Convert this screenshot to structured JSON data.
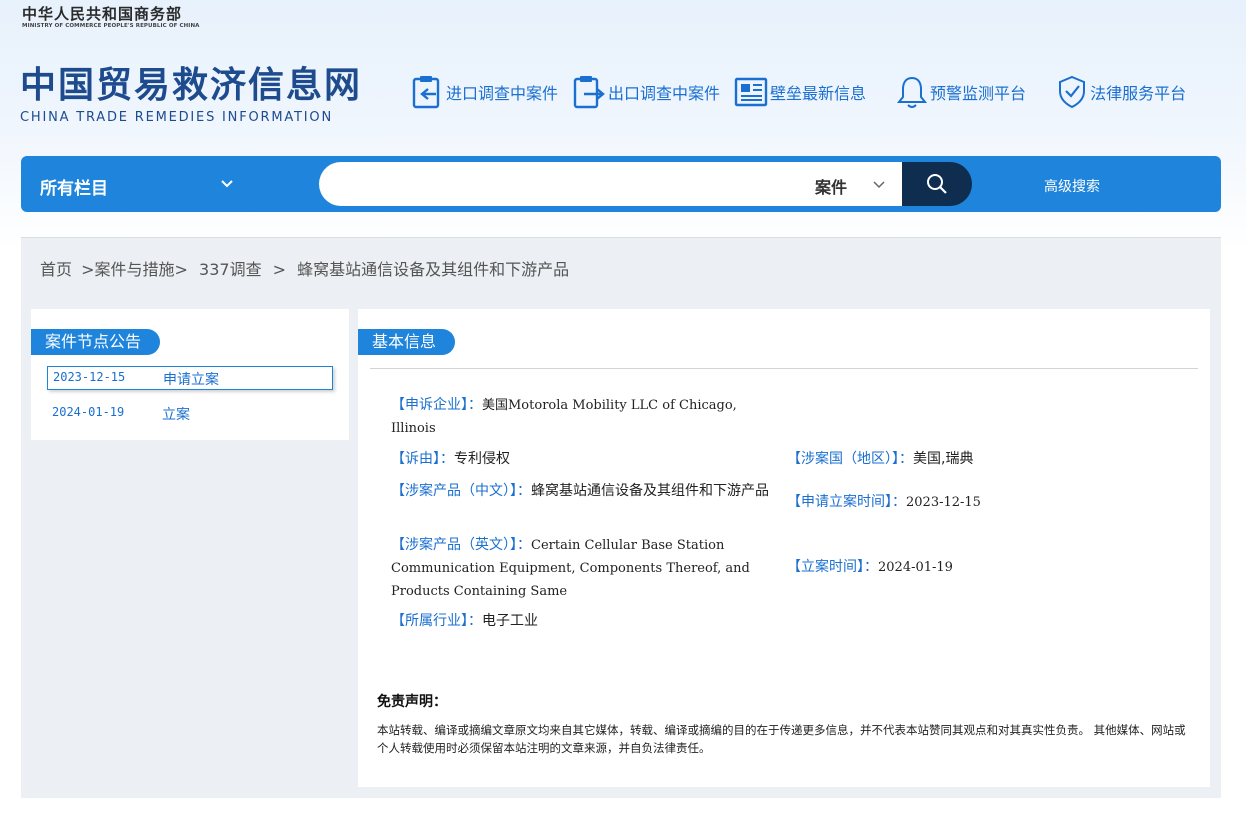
{
  "header": {
    "ministry_cn": "中华人民共和国商务部",
    "ministry_en": "MINISTRY OF COMMERCE PEOPLE'S REPUBLIC OF CHINA",
    "site_title_cn": "中国贸易救济信息网",
    "site_title_en": "CHINA TRADE REMEDIES INFORMATION",
    "nav": [
      {
        "label": "进口调查中案件",
        "icon": "import-clipboard-icon"
      },
      {
        "label": "出口调查中案件",
        "icon": "export-clipboard-icon"
      },
      {
        "label": "壁垒最新信息",
        "icon": "news-icon"
      },
      {
        "label": "预警监测平台",
        "icon": "bell-icon"
      },
      {
        "label": "法律服务平台",
        "icon": "shield-check-icon"
      }
    ],
    "accent_color": "#1e84dc"
  },
  "search": {
    "category_label": "所有栏目",
    "input_value": "",
    "type_label": "案件",
    "advanced_label": "高级搜索"
  },
  "breadcrumb": {
    "items": [
      "首页",
      ">案件与措施>",
      "337调查",
      ">",
      "蜂窝基站通信设备及其组件和下游产品"
    ]
  },
  "left_panel": {
    "title": "案件节点公告",
    "events": [
      {
        "date": "2023-12-15",
        "title": "申请立案"
      },
      {
        "date": "2024-01-19",
        "title": "立案"
      }
    ]
  },
  "basic_info": {
    "title": "基本信息",
    "applicant": {
      "label": "【申诉企业】：",
      "value": "美国Motorola Mobility LLC of Chicago, Illinois"
    },
    "cause": {
      "label": "【诉由】：",
      "value": "专利侵权"
    },
    "country": {
      "label": "【涉案国（地区）】：",
      "value": "美国,瑞典"
    },
    "product_cn": {
      "label": "【涉案产品（中文）】：",
      "value": "蜂窝基站通信设备及其组件和下游产品"
    },
    "filing_date": {
      "label": "【申请立案时间】：",
      "value": "2023-12-15"
    },
    "product_en": {
      "label": "【涉案产品（英文）】：",
      "value": "Certain Cellular Base Station Communication Equipment, Components Thereof, and Products Containing Same"
    },
    "init_date": {
      "label": "【立案时间】：",
      "value": "2024-01-19"
    },
    "industry": {
      "label": "【所属行业】：",
      "value": "电子工业"
    }
  },
  "disclaimer": {
    "title": "免责声明：",
    "text": "本站转载、编译或摘编文章原文均来自其它媒体，转载、编译或摘编的目的在于传递更多信息，并不代表本站赞同其观点和对其真实性负责。 其他媒体、网站或个人转载使用时必须保留本站注明的文章来源，并自负法律责任。"
  }
}
